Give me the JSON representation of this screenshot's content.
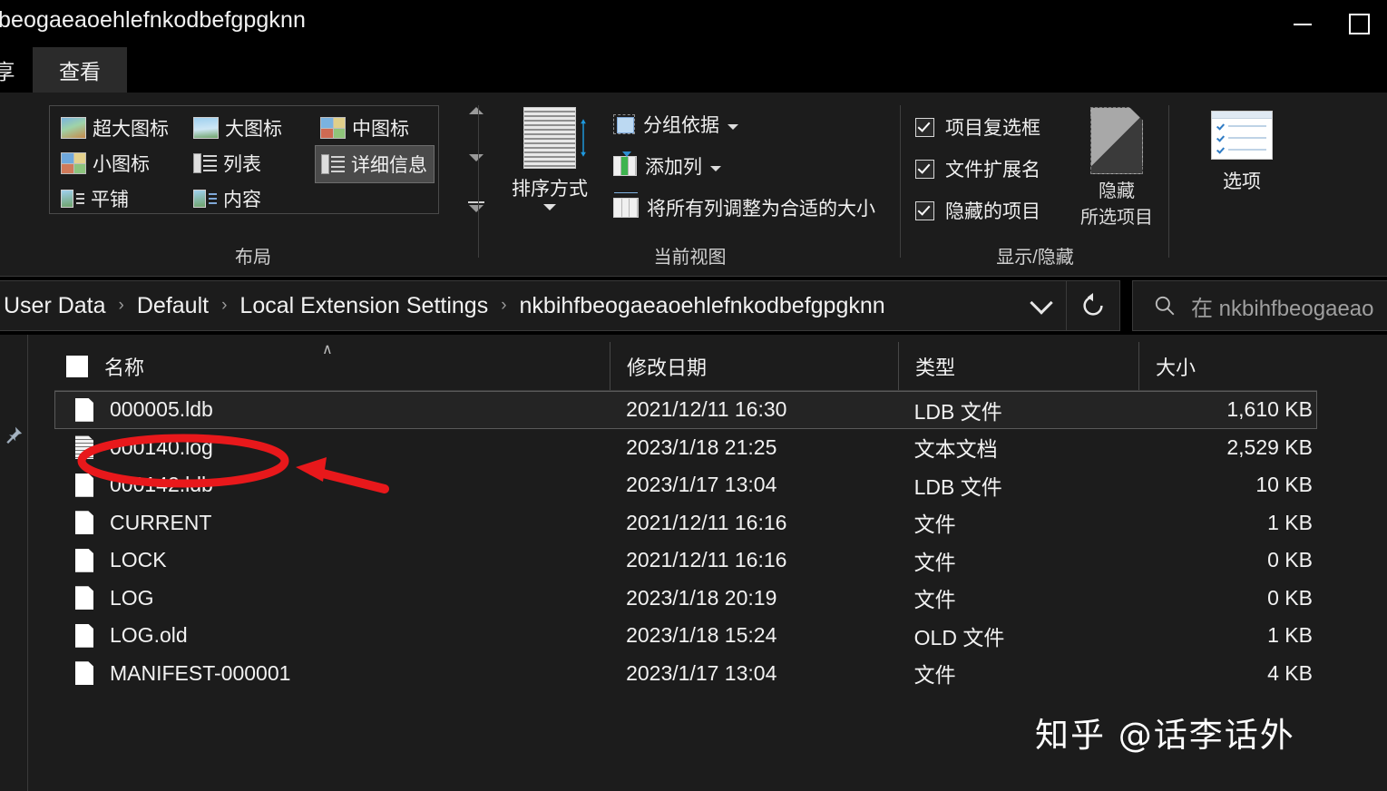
{
  "window": {
    "title": "beogaeaoehlefnkodbefgpgknn",
    "minimize_label": "minimize",
    "maximize_label": "maximize"
  },
  "ribbon": {
    "tabs": [
      {
        "label": "享",
        "active": false
      },
      {
        "label": "查看",
        "active": true
      }
    ],
    "groups": {
      "layout": {
        "title": "布局",
        "views": [
          {
            "label": "超大图标",
            "icon": "extra-large-icons-icon",
            "selected": false
          },
          {
            "label": "大图标",
            "icon": "large-icons-icon",
            "selected": false
          },
          {
            "label": "中图标",
            "icon": "medium-icons-icon",
            "selected": false
          },
          {
            "label": "小图标",
            "icon": "small-icons-icon",
            "selected": false
          },
          {
            "label": "列表",
            "icon": "list-view-icon",
            "selected": false
          },
          {
            "label": "详细信息",
            "icon": "details-view-icon",
            "selected": true
          },
          {
            "label": "平铺",
            "icon": "tiles-view-icon",
            "selected": false
          },
          {
            "label": "内容",
            "icon": "content-view-icon",
            "selected": false
          }
        ]
      },
      "current_view": {
        "title": "当前视图",
        "sort_by": "排序方式",
        "items": [
          {
            "label": "分组依据",
            "icon": "group-by-icon",
            "has_dropdown": true
          },
          {
            "label": "添加列",
            "icon": "add-columns-icon",
            "has_dropdown": true
          },
          {
            "label": "将所有列调整为合适的大小",
            "icon": "size-all-columns-icon",
            "has_dropdown": false
          }
        ]
      },
      "show_hide": {
        "title": "显示/隐藏",
        "checkboxes": [
          {
            "label": "项目复选框",
            "checked": true
          },
          {
            "label": "文件扩展名",
            "checked": true
          },
          {
            "label": "隐藏的项目",
            "checked": true
          }
        ],
        "hide_selected_line1": "隐藏",
        "hide_selected_line2": "所选项目"
      },
      "options": {
        "label": "选项"
      }
    }
  },
  "address_bar": {
    "breadcrumbs": [
      "User Data",
      "Default",
      "Local Extension Settings",
      "nkbihfbeogaeaoehlefnkodbefgpgknn"
    ],
    "separator": "›",
    "dropdown_icon": "chevron-down-icon",
    "refresh_icon": "refresh-icon"
  },
  "search": {
    "icon": "search-icon",
    "placeholder": "在 nkbihfbeogaeao"
  },
  "file_list": {
    "columns": [
      {
        "key": "name",
        "label": "名称"
      },
      {
        "key": "date",
        "label": "修改日期"
      },
      {
        "key": "type",
        "label": "类型"
      },
      {
        "key": "size",
        "label": "大小"
      }
    ],
    "sort_indicator": "∧",
    "rows": [
      {
        "name": "000005.ldb",
        "date": "2021/12/11 16:30",
        "type": "LDB 文件",
        "size": "1,610 KB",
        "icon": "file-icon",
        "focused": true
      },
      {
        "name": "000140.log",
        "date": "2023/1/18 21:25",
        "type": "文本文档",
        "size": "2,529 KB",
        "icon": "text-file-icon",
        "focused": false
      },
      {
        "name": "000142.ldb",
        "date": "2023/1/17 13:04",
        "type": "LDB 文件",
        "size": "10 KB",
        "icon": "file-icon",
        "focused": false
      },
      {
        "name": "CURRENT",
        "date": "2021/12/11 16:16",
        "type": "文件",
        "size": "1 KB",
        "icon": "file-icon",
        "focused": false
      },
      {
        "name": "LOCK",
        "date": "2021/12/11 16:16",
        "type": "文件",
        "size": "0 KB",
        "icon": "file-icon",
        "focused": false
      },
      {
        "name": "LOG",
        "date": "2023/1/18 20:19",
        "type": "文件",
        "size": "0 KB",
        "icon": "file-icon",
        "focused": false
      },
      {
        "name": "LOG.old",
        "date": "2023/1/18 15:24",
        "type": "OLD 文件",
        "size": "1 KB",
        "icon": "file-icon",
        "focused": false
      },
      {
        "name": "MANIFEST-000001",
        "date": "2023/1/17 13:04",
        "type": "文件",
        "size": "4 KB",
        "icon": "file-icon",
        "focused": false
      }
    ]
  },
  "annotations": {
    "highlight_color": "#e8181b",
    "ellipse_target": "000140.log",
    "arrow": "points-left-to-highlighted-file"
  },
  "watermark": {
    "text": "知乎 @话李话外"
  },
  "colors": {
    "window_bg": "#000000",
    "ribbon_bg": "#1c1c1c",
    "tab_active_bg": "#2b2b2b",
    "text": "#f2f2f2",
    "muted_text": "#9f9f9f",
    "annotation_red": "#e8181b"
  }
}
